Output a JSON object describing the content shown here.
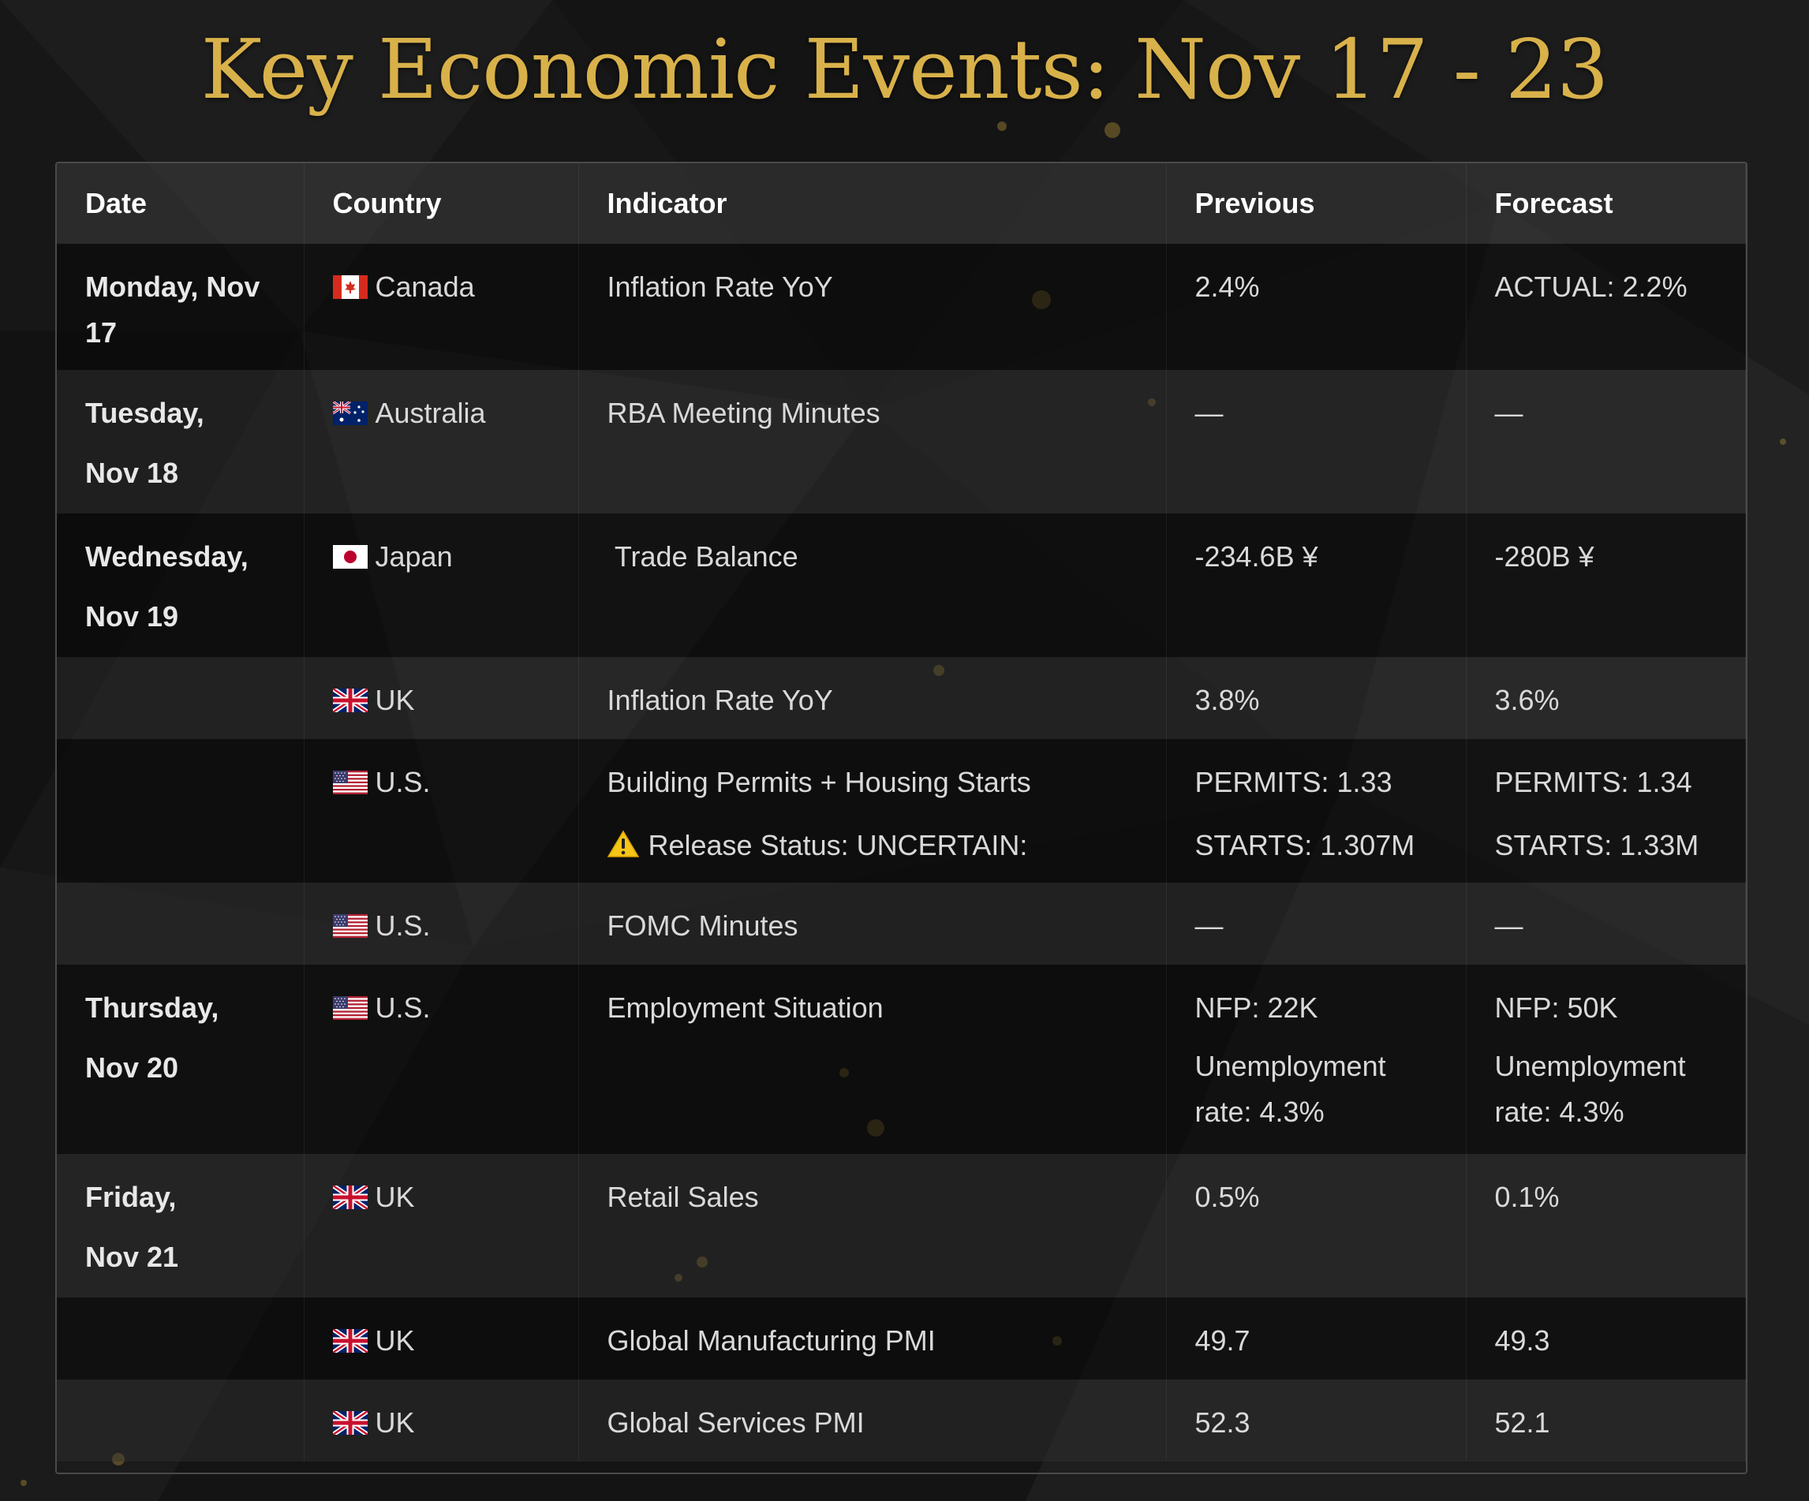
{
  "title": "Key Economic Events: Nov 17 - 23",
  "columns": [
    "Date",
    "Country",
    "Indicator",
    "Previous",
    "Forecast"
  ],
  "rows": [
    {
      "date1": "Monday, Nov",
      "date2": "17",
      "flag": "canada-flag-icon",
      "country": "Canada",
      "indicator": "Inflation Rate YoY",
      "indicator2": "",
      "previous": "2.4%",
      "previous2": "",
      "previous3": "",
      "forecast": "ACTUAL: 2.2%",
      "forecast2": "",
      "forecast3": ""
    },
    {
      "date1": "Tuesday,",
      "date2": "Nov 18",
      "flag": "australia-flag-icon",
      "country": "Australia",
      "indicator": "RBA Meeting Minutes",
      "indicator2": "",
      "previous": "—",
      "previous2": "",
      "previous3": "",
      "forecast": "—",
      "forecast2": "",
      "forecast3": ""
    },
    {
      "date1": "Wednesday,",
      "date2": "Nov 19",
      "flag": "japan-flag-icon",
      "country": "Japan",
      "indicator": " Trade Balance",
      "indicator2": "",
      "previous": "-234.6B ¥",
      "previous2": "",
      "previous3": "",
      "forecast": "-280B ¥",
      "forecast2": "",
      "forecast3": ""
    },
    {
      "date1": "",
      "date2": "",
      "flag": "uk-flag-icon",
      "country": "UK",
      "indicator": "Inflation Rate YoY",
      "indicator2": "",
      "previous": "3.8%",
      "previous2": "",
      "previous3": "",
      "forecast": "3.6%",
      "forecast2": "",
      "forecast3": ""
    },
    {
      "date1": "",
      "date2": "",
      "flag": "us-flag-icon",
      "country": "U.S.",
      "indicator": "Building Permits + Housing Starts",
      "indicator2": "Release Status: UNCERTAIN:",
      "previous": "PERMITS: 1.33",
      "previous2": "STARTS: 1.307M",
      "previous3": "",
      "forecast": "PERMITS: 1.34",
      "forecast2": "STARTS: 1.33M",
      "forecast3": ""
    },
    {
      "date1": "",
      "date2": "",
      "flag": "us-flag-icon",
      "country": "U.S.",
      "indicator": "FOMC Minutes",
      "indicator2": "",
      "previous": "—",
      "previous2": "",
      "previous3": "",
      "forecast": "—",
      "forecast2": "",
      "forecast3": ""
    },
    {
      "date1": "Thursday,",
      "date2": "Nov 20",
      "flag": "us-flag-icon",
      "country": "U.S.",
      "indicator": "Employment Situation",
      "indicator2": "",
      "previous": "NFP: 22K",
      "previous2": "Unemployment",
      "previous3": "rate: 4.3%",
      "forecast": "NFP: 50K",
      "forecast2": "Unemployment",
      "forecast3": "rate: 4.3%"
    },
    {
      "date1": "Friday,",
      "date2": "Nov 21",
      "flag": "uk-flag-icon",
      "country": "UK",
      "indicator": "Retail Sales",
      "indicator2": "",
      "previous": "0.5%",
      "previous2": "",
      "previous3": "",
      "forecast": "0.1%",
      "forecast2": "",
      "forecast3": ""
    },
    {
      "date1": "",
      "date2": "",
      "flag": "uk-flag-icon",
      "country": "UK",
      "indicator": "Global Manufacturing PMI",
      "indicator2": "",
      "previous": "49.7",
      "previous2": "",
      "previous3": "",
      "forecast": "49.3",
      "forecast2": "",
      "forecast3": ""
    },
    {
      "date1": "",
      "date2": "",
      "flag": "uk-flag-icon",
      "country": "UK",
      "indicator": "Global Services PMI",
      "indicator2": "",
      "previous": "52.3",
      "previous2": "",
      "previous3": "",
      "forecast": "52.1",
      "forecast2": "",
      "forecast3": ""
    }
  ],
  "colors": {
    "title_gold": "#d8b14a",
    "background": "#161616",
    "text": "#d9d9d9"
  }
}
